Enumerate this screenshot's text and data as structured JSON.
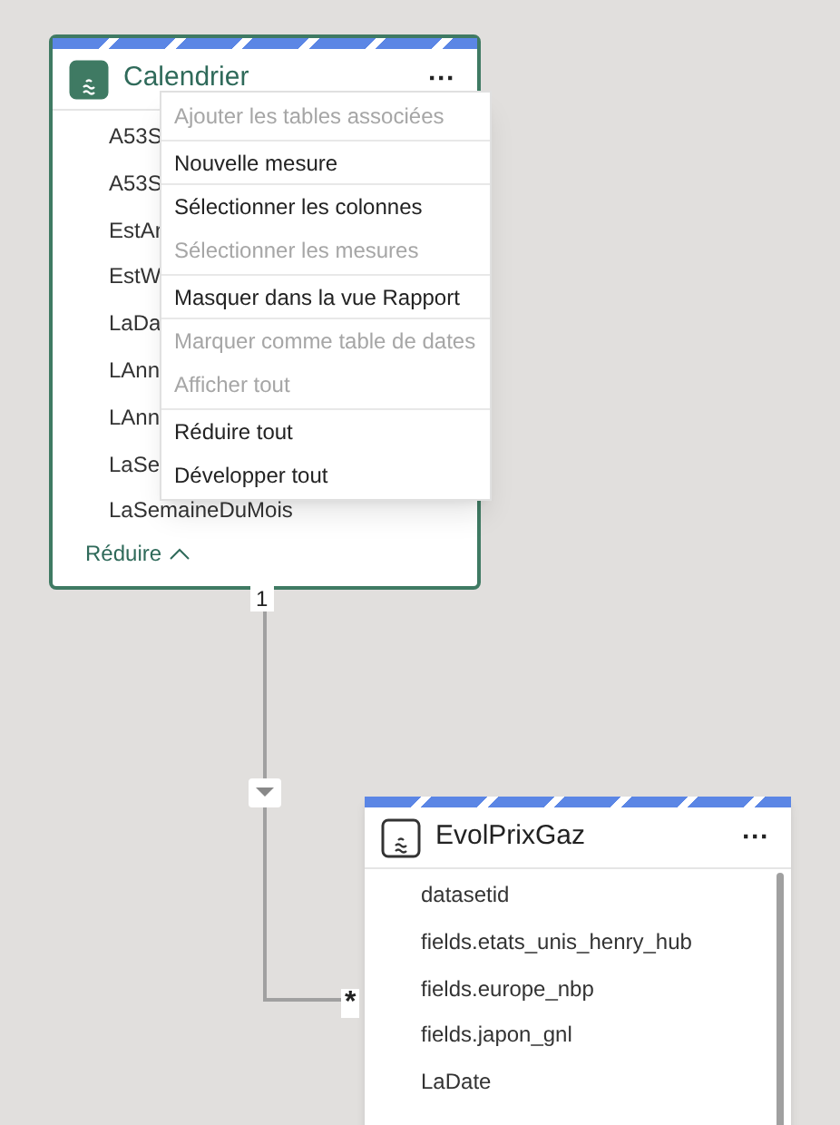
{
  "tables": [
    {
      "title": "Calendrier",
      "selected": true,
      "fields": [
        "A53S",
        "A53S",
        "EstAr",
        "EstW",
        "LaDa",
        "LAnn",
        "LAnn",
        "LaSe",
        "LaSemaineDuMois"
      ],
      "more": "···",
      "collapse": "Réduire"
    },
    {
      "title": "EvolPrixGaz",
      "selected": false,
      "fields": [
        "datasetid",
        "fields.etats_unis_henry_hub",
        "fields.europe_nbp",
        "fields.japon_gnl",
        "LaDate"
      ],
      "more": "···"
    }
  ],
  "relationship": {
    "from_cardinality": "1",
    "to_cardinality": "*"
  },
  "context_menu": [
    {
      "label": "Ajouter les tables associées",
      "disabled": true
    },
    {
      "label": "Nouvelle mesure",
      "disabled": false
    },
    {
      "label": "Sélectionner les colonnes",
      "disabled": false
    },
    {
      "label": "Sélectionner les mesures",
      "disabled": true
    },
    {
      "label": "Masquer dans la vue Rapport",
      "disabled": false
    },
    {
      "label": "Marquer comme table de dates",
      "disabled": true
    },
    {
      "label": "Afficher tout",
      "disabled": true
    },
    {
      "label": "Réduire tout",
      "disabled": false
    },
    {
      "label": "Développer tout",
      "disabled": false
    }
  ]
}
